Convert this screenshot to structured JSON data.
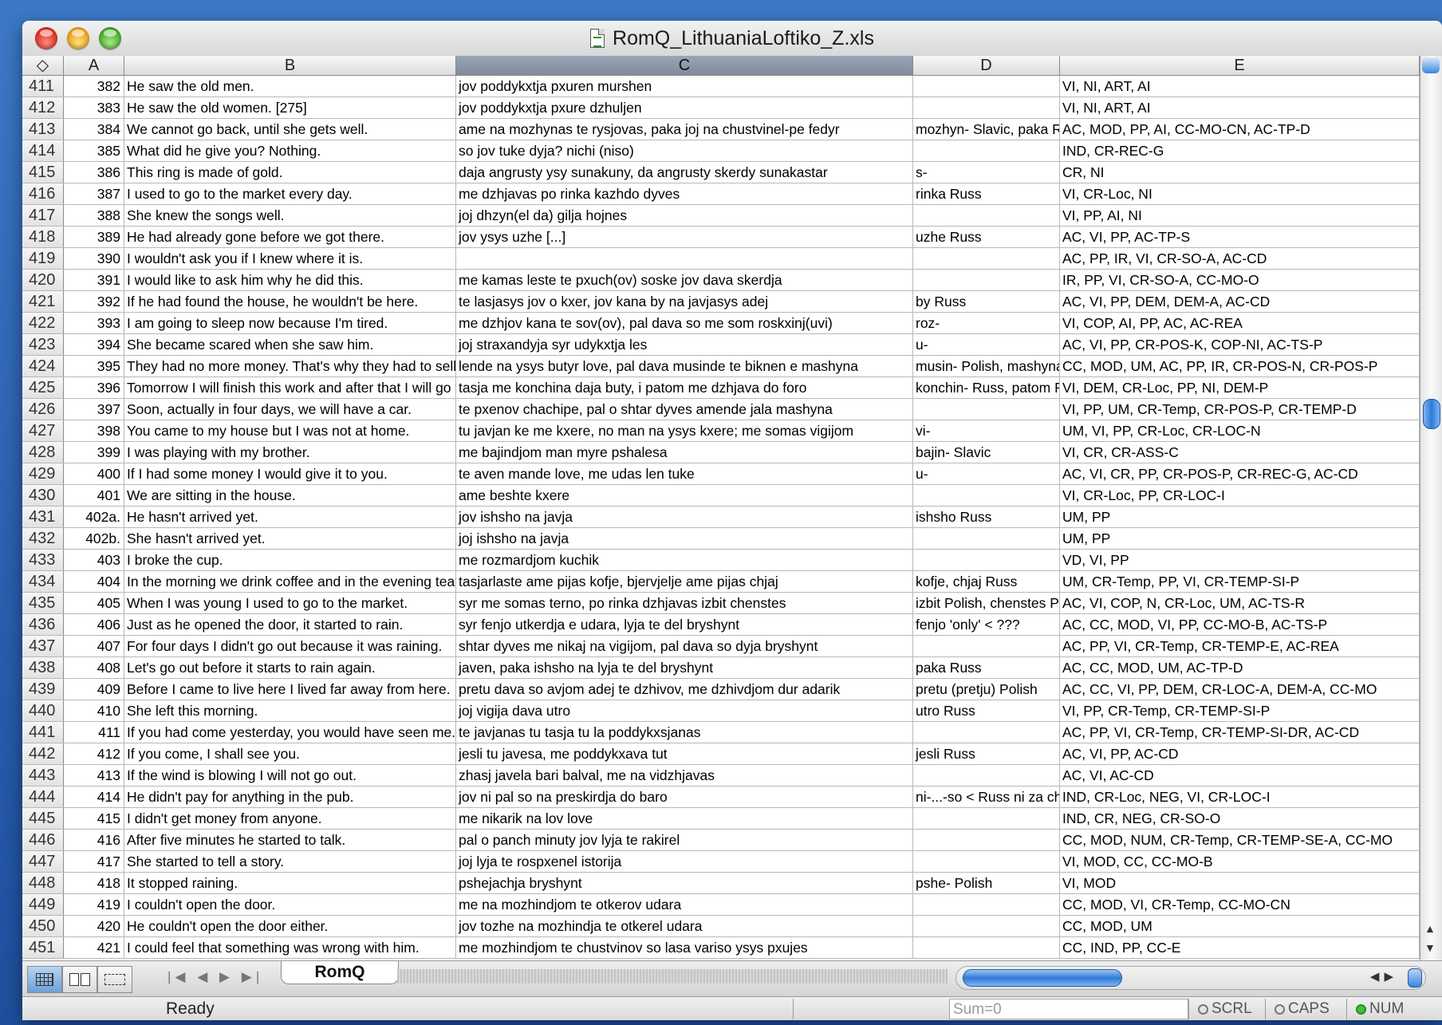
{
  "window": {
    "title": "RomQ_LithuaniaLoftiko_Z.xls"
  },
  "columns": {
    "corner": "◇",
    "a": "A",
    "b": "B",
    "c": "C",
    "d": "D",
    "e": "E"
  },
  "rows": [
    {
      "n": "411",
      "a": "382",
      "b": "He saw the old men.",
      "c": "jov poddykxtja pxuren murshen",
      "d": "",
      "e": "VI, NI, ART, AI"
    },
    {
      "n": "412",
      "a": "383",
      "b": "He saw the old women. [275]",
      "c": "jov poddykxtja pxure dzhuljen",
      "d": "",
      "e": "VI, NI, ART, AI"
    },
    {
      "n": "413",
      "a": "384",
      "b": "We cannot go back, until she gets well.",
      "c": "ame na mozhynas te rysjovas, paka joj na chustvinel-pe fedyr",
      "d": "mozhyn- Slavic, paka Russ",
      "e": "AC, MOD, PP, AI, CC-MO-CN, AC-TP-D"
    },
    {
      "n": "414",
      "a": "385",
      "b": "What did he give you? Nothing.",
      "c": "so jov tuke dyja? nichi (niso)",
      "d": "",
      "e": "IND, CR-REC-G"
    },
    {
      "n": "415",
      "a": "386",
      "b": "This ring is made of gold.",
      "c": "daja angrusty ysy sunakuny, da angrusty skerdy sunakastar",
      "d": "s-",
      "e": "CR, NI"
    },
    {
      "n": "416",
      "a": "387",
      "b": "I used to go to the market every day.",
      "c": "me dzhjavas po rinka kazhdo dyves",
      "d": "rinka Russ",
      "e": "VI, CR-Loc, NI"
    },
    {
      "n": "417",
      "a": "388",
      "b": "She knew  the songs well.",
      "c": "joj dhzyn(el da) gilja hojnes",
      "d": "",
      "e": "VI, PP, AI, NI"
    },
    {
      "n": "418",
      "a": "389",
      "b": "He had already gone before we got there.",
      "c": "jov ysys uzhe [...]",
      "d": "uzhe Russ",
      "e": "AC, VI, PP, AC-TP-S"
    },
    {
      "n": "419",
      "a": "390",
      "b": "I wouldn't ask you if I knew where it is.",
      "c": "",
      "d": "",
      "e": "AC, PP, IR, VI, CR-SO-A, AC-CD"
    },
    {
      "n": "420",
      "a": "391",
      "b": "I would like to ask him why he did this.",
      "c": "me kamas leste te pxuch(ov) soske jov dava skerdja",
      "d": "",
      "e": "IR, PP, VI, CR-SO-A, CC-MO-O"
    },
    {
      "n": "421",
      "a": "392",
      "b": "If he had found the house, he wouldn't be here.",
      "c": "te lasjasys jov o kxer, jov kana by na javjasys adej",
      "d": "by Russ",
      "e": "AC, VI, PP, DEM, DEM-A, AC-CD"
    },
    {
      "n": "422",
      "a": "393",
      "b": "I am going to sleep now because I'm tired.",
      "c": "me dzhjov kana te sov(ov), pal dava so me som roskxinj(uvi)",
      "d": "roz-",
      "e": "VI, COP, AI, PP, AC, AC-REA"
    },
    {
      "n": "423",
      "a": "394",
      "b": "She became scared when she saw him.",
      "c": "joj straxandyja syr udykxtja les",
      "d": "u-",
      "e": "AC, VI, PP, CR-POS-K, COP-NI, AC-TS-P"
    },
    {
      "n": "424",
      "a": "395",
      "b": "They had no more money. That's why they had to sell the car.",
      "c": "lende na ysys butyr love, pal dava musinde te biknen e mashyna",
      "d": "musin- Polish, mashyna Russ",
      "e": "CC, MOD, UM, AC, PP, IR, CR-POS-N, CR-POS-P"
    },
    {
      "n": "425",
      "a": "396",
      "b": "Tomorrow I will finish this work and after that I will go to town.",
      "c": "tasja me konchina daja buty, i patom me dzhjava do foro",
      "d": "konchin- Russ, patom Russ",
      "e": "VI, DEM, CR-Loc, PP, NI, DEM-P"
    },
    {
      "n": "426",
      "a": "397",
      "b": "Soon, actually in four days, we will have a car.",
      "c": "te pxenov chachipe, pal o shtar dyves amende jala mashyna",
      "d": "",
      "e": "VI, PP, UM, CR-Temp, CR-POS-P, CR-TEMP-D"
    },
    {
      "n": "427",
      "a": "398",
      "b": "You came to my house but I was not at home.",
      "c": "tu javjan ke me kxere, no man na ysys kxere; me somas vigijom",
      "d": "vi-",
      "e": "UM, VI, PP, CR-Loc, CR-LOC-N"
    },
    {
      "n": "428",
      "a": "399",
      "b": "I was playing with my brother.",
      "c": "me bajindjom man myre pshalesa",
      "d": "bajin- Slavic",
      "e": "VI, CR, CR-ASS-C"
    },
    {
      "n": "429",
      "a": "400",
      "b": "If I had some money I would give it to you.",
      "c": "te aven mande love, me udas len tuke",
      "d": "u-",
      "e": "AC, VI, CR, PP, CR-POS-P, CR-REC-G, AC-CD"
    },
    {
      "n": "430",
      "a": "401",
      "b": "We are sitting in the house.",
      "c": "ame beshte kxere",
      "d": "",
      "e": "VI, CR-Loc, PP, CR-LOC-I"
    },
    {
      "n": "431",
      "a": "402a.",
      "b": "He hasn't arrived yet.",
      "c": "jov ishsho na javja",
      "d": "ishsho Russ",
      "e": "UM, PP"
    },
    {
      "n": "432",
      "a": "402b.",
      "b": "She hasn't arrived yet.",
      "c": "joj ishsho na javja",
      "d": "",
      "e": "UM, PP"
    },
    {
      "n": "433",
      "a": "403",
      "b": "I broke the cup.",
      "c": "me rozmardjom kuchik",
      "d": "",
      "e": "VD, VI, PP"
    },
    {
      "n": "434",
      "a": "404",
      "b": "In the morning we drink coffee and in the evening tea.",
      "c": "tasjarlaste ame pijas kofje, bjervjelje ame pijas chjaj",
      "d": "kofje, chjaj Russ",
      "e": "UM, CR-Temp, PP, VI, CR-TEMP-SI-P"
    },
    {
      "n": "435",
      "a": "405",
      "b": "When I was young I used to go to the market.",
      "c": "syr me somas terno, po rinka dzhjavas izbit chenstes",
      "d": "izbit Polish, chenstes Polish",
      "e": "AC, VI, COP, N, CR-Loc, UM, AC-TS-R"
    },
    {
      "n": "436",
      "a": "406",
      "b": "Just as he opened the door, it started to rain.",
      "c": "syr fenjo utkerdja e udara, lyja te del bryshynt",
      "d": "fenjo 'only' < ???",
      "e": "AC, CC, MOD, VI, PP, CC-MO-B, AC-TS-P"
    },
    {
      "n": "437",
      "a": "407",
      "b": "For four days I didn't go out because it was raining.",
      "c": "shtar dyves me nikaj na vigijom, pal dava so dyja bryshynt",
      "d": "",
      "e": "AC, PP, VI, CR-Temp, CR-TEMP-E, AC-REA"
    },
    {
      "n": "438",
      "a": "408",
      "b": "Let's go out before it starts to rain again.",
      "c": "javen, paka ishsho na lyja te del bryshynt",
      "d": "paka Russ",
      "e": "AC, CC, MOD, UM, AC-TP-D"
    },
    {
      "n": "439",
      "a": "409",
      "b": "Before I came to live here I lived far away from here.",
      "c": "pretu dava so avjom adej te dzhivov, me dzhivdjom dur adarik",
      "d": "pretu (pretju) Polish",
      "e": "AC, CC, VI, PP, DEM, CR-LOC-A, DEM-A, CC-MO"
    },
    {
      "n": "440",
      "a": "410",
      "b": "She left this morning.",
      "c": "joj vigija dava utro",
      "d": "utro Russ",
      "e": "VI, PP, CR-Temp, CR-TEMP-SI-P"
    },
    {
      "n": "441",
      "a": "411",
      "b": "If you had come yesterday, you would have seen me.",
      "c": "te javjanas tu tasja tu la poddykxsjanas",
      "d": "",
      "e": "AC, PP, VI, CR-Temp, CR-TEMP-SI-DR, AC-CD"
    },
    {
      "n": "442",
      "a": "412",
      "b": "If you come, I shall see you.",
      "c": "jesli tu javesa, me poddykxava tut",
      "d": "jesli Russ",
      "e": "AC, VI, PP, AC-CD"
    },
    {
      "n": "443",
      "a": "413",
      "b": "If the wind is blowing I will not go out.",
      "c": "zhasj javela bari balval, me na vidzhjavas",
      "d": "",
      "e": "AC, VI, AC-CD"
    },
    {
      "n": "444",
      "a": "414",
      "b": "He didn't pay for anything in the pub.",
      "c": "jov ni pal so na preskirdja do baro",
      "d": "ni-...-so < Russ ni za chto",
      "e": "IND, CR-Loc, NEG, VI, CR-LOC-I"
    },
    {
      "n": "445",
      "a": "415",
      "b": "I didn't get money from anyone.",
      "c": "me nikarik na lov love",
      "d": "",
      "e": "IND, CR, NEG, CR-SO-O"
    },
    {
      "n": "446",
      "a": "416",
      "b": "After five minutes he started to talk.",
      "c": "pal o panch minuty jov lyja te rakirel",
      "d": "",
      "e": "CC, MOD, NUM, CR-Temp, CR-TEMP-SE-A, CC-MO"
    },
    {
      "n": "447",
      "a": "417",
      "b": "She started to tell a story.",
      "c": "joj lyja te rospxenel istorija",
      "d": "",
      "e": "VI, MOD, CC, CC-MO-B"
    },
    {
      "n": "448",
      "a": "418",
      "b": "It stopped raining.",
      "c": "pshejachja bryshynt",
      "d": "pshe- Polish",
      "e": "VI, MOD"
    },
    {
      "n": "449",
      "a": "419",
      "b": "I couldn't open the door.",
      "c": "me na mozhindjom te otkerov udara",
      "d": "",
      "e": "CC, MOD, VI, CR-Temp, CC-MO-CN"
    },
    {
      "n": "450",
      "a": "420",
      "b": "He couldn't open the door either.",
      "c": "jov tozhe na mozhindja te otkerel udara",
      "d": "",
      "e": "CC, MOD, UM"
    },
    {
      "n": "451",
      "a": "421",
      "b": "I could feel that something was wrong with him.",
      "c": "me mozhindjom te chustvinov so lasa variso ysys pxujes",
      "d": "",
      "e": "CC, IND, PP, CC-E"
    }
  ],
  "tabs": {
    "active": "RomQ"
  },
  "status": {
    "ready": "Ready",
    "sum": "Sum=0",
    "scrl": "SCRL",
    "caps": "CAPS",
    "num": "NUM"
  },
  "colors": {
    "selected_header": "#8a96a6",
    "scroll_blue": "#2f7ad8",
    "num_indicator": "#3ac43a"
  }
}
